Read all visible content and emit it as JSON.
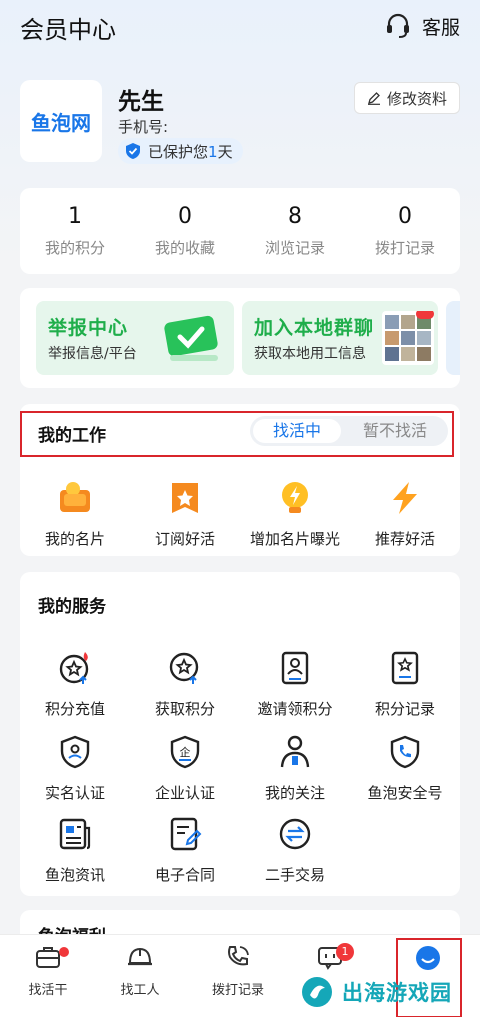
{
  "header": {
    "title": "会员中心",
    "service_label": "客服"
  },
  "profile": {
    "logo_text": "鱼泡网",
    "name": "先生",
    "phone_label": "手机号:",
    "protect_prefix": "已保护您",
    "protect_days": "1",
    "protect_suffix": "天",
    "edit_label": "修改资料"
  },
  "stats": [
    {
      "value": "1",
      "label": "我的积分"
    },
    {
      "value": "0",
      "label": "我的收藏"
    },
    {
      "value": "8",
      "label": "浏览记录"
    },
    {
      "value": "0",
      "label": "拨打记录"
    }
  ],
  "banners": [
    {
      "title": "举报中心",
      "subtitle": "举报信息/平台"
    },
    {
      "title": "加入本地群聊",
      "subtitle": "获取本地用工信息"
    }
  ],
  "work": {
    "title": "我的工作",
    "status_on": "找活中",
    "status_off": "暂不找活",
    "items": [
      {
        "label": "我的名片",
        "icon": "card-icon"
      },
      {
        "label": "订阅好活",
        "icon": "bookmark-star-icon"
      },
      {
        "label": "增加名片曝光",
        "icon": "lightning-bulb-icon"
      },
      {
        "label": "推荐好活",
        "icon": "lightning-icon"
      }
    ]
  },
  "services": {
    "title": "我的服务",
    "items": [
      {
        "label": "积分充值",
        "icon": "points-recharge-icon"
      },
      {
        "label": "获取积分",
        "icon": "points-get-icon"
      },
      {
        "label": "邀请领积分",
        "icon": "invite-icon"
      },
      {
        "label": "积分记录",
        "icon": "points-record-icon"
      },
      {
        "label": "实名认证",
        "icon": "shield-id-icon"
      },
      {
        "label": "企业认证",
        "icon": "enterprise-shield-icon"
      },
      {
        "label": "我的关注",
        "icon": "follow-user-icon"
      },
      {
        "label": "鱼泡安全号",
        "icon": "safe-phone-icon"
      },
      {
        "label": "鱼泡资讯",
        "icon": "news-icon"
      },
      {
        "label": "电子合同",
        "icon": "contract-icon"
      },
      {
        "label": "二手交易",
        "icon": "exchange-icon"
      }
    ]
  },
  "next_section": {
    "title": "鱼泡福利"
  },
  "tabbar": {
    "items": [
      {
        "label": "找活干",
        "icon": "briefcase-icon"
      },
      {
        "label": "找工人",
        "icon": "helmet-icon"
      },
      {
        "label": "拨打记录",
        "icon": "phone-icon"
      },
      {
        "label": "",
        "icon": "message-icon",
        "badge": "1"
      },
      {
        "label": "",
        "icon": "profile-icon"
      }
    ]
  },
  "watermark": {
    "text": "出海游戏园"
  },
  "colors": {
    "accent": "#1976e8",
    "green": "#1fae4b",
    "red": "#f0373a",
    "highlight_box": "#d9252b"
  }
}
